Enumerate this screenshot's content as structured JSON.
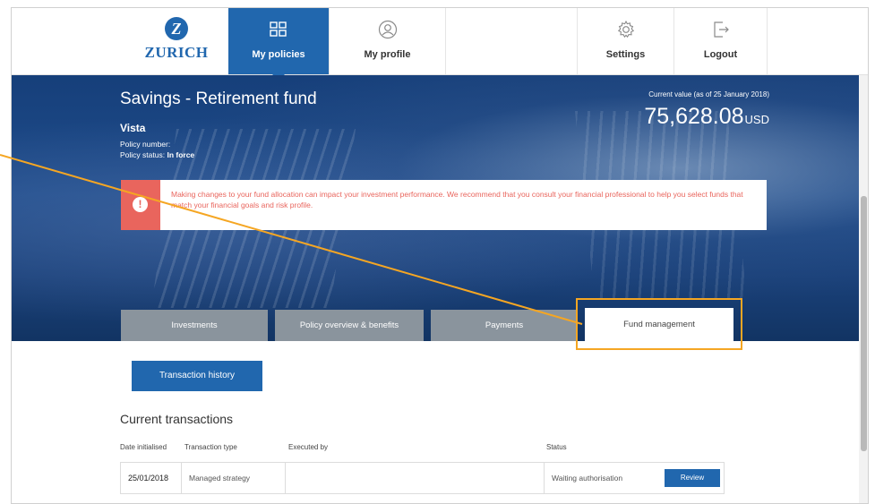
{
  "brand": {
    "name": "ZURICH",
    "mark": "Z",
    "color": "#2167ae"
  },
  "nav": [
    {
      "label": "My policies",
      "icon": "grid-icon",
      "active": true
    },
    {
      "label": "My profile",
      "icon": "user-icon",
      "active": false
    },
    {
      "label": "Settings",
      "icon": "gear-icon",
      "active": false
    },
    {
      "label": "Logout",
      "icon": "logout-icon",
      "active": false
    }
  ],
  "policy": {
    "title": "Savings - Retirement fund",
    "name": "Vista",
    "number_label": "Policy number:",
    "status_label": "Policy status:",
    "status_value": "In force"
  },
  "current_value": {
    "label": "Current value (as of 25 January 2018)",
    "amount": "75,628.08",
    "currency": "USD"
  },
  "alert": {
    "icon": "exclamation-icon",
    "color": "#e9655d",
    "text": "Making changes to your fund allocation can impact your investment performance. We recommend that you consult your financial professional to help you select funds that match your financial goals and risk profile."
  },
  "tabs": [
    {
      "label": "Investments",
      "active": false
    },
    {
      "label": "Policy overview & benefits",
      "active": false
    },
    {
      "label": "Payments",
      "active": false
    },
    {
      "label": "Fund management",
      "active": true
    }
  ],
  "transaction_history_button": "Transaction history",
  "current_transactions": {
    "title": "Current transactions",
    "columns": [
      "Date initialised",
      "Transaction type",
      "Executed by",
      "Status"
    ],
    "rows": [
      {
        "date": "25/01/2018",
        "type": "Managed strategy",
        "executed_by": "",
        "status": "Waiting authorisation",
        "action": "Review"
      }
    ]
  },
  "annotation": {
    "color": "#f5a623"
  }
}
